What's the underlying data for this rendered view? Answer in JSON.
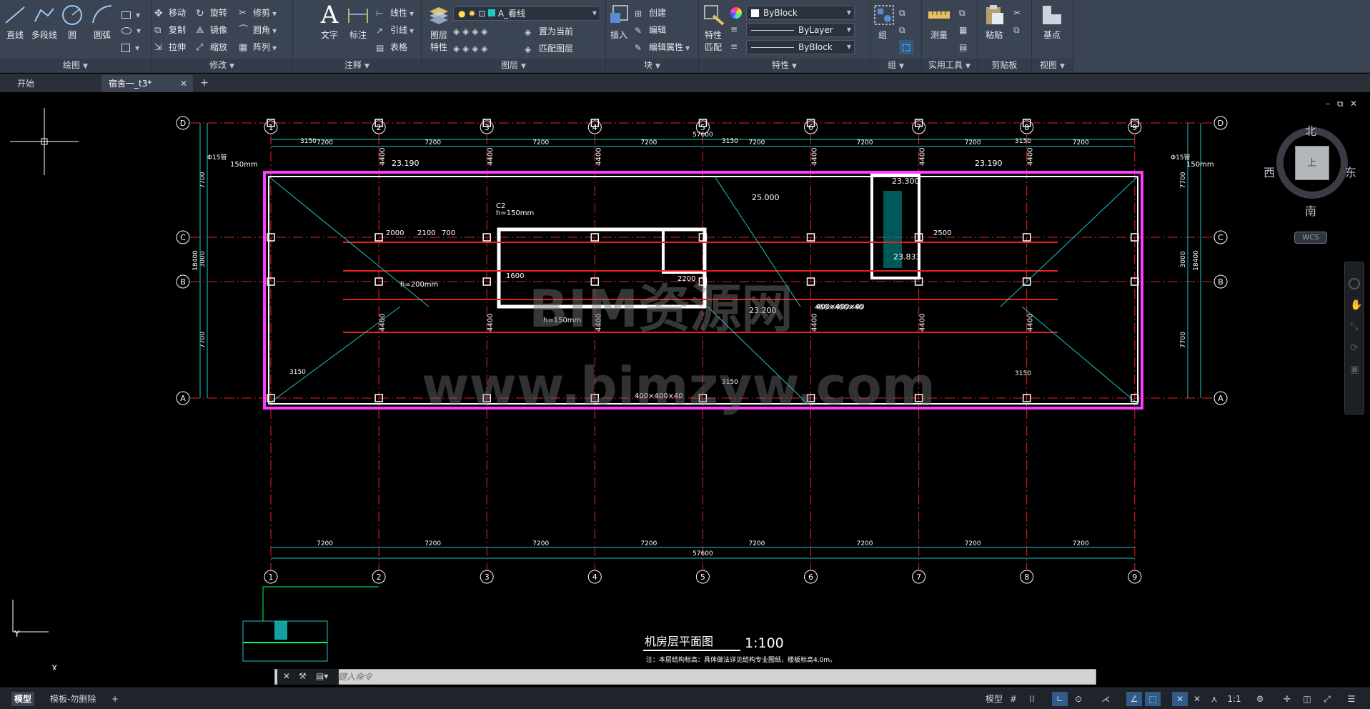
{
  "ribbon": {
    "panels": {
      "draw": {
        "title": "绘图",
        "line": "直线",
        "polyline": "多段线",
        "circle": "圆",
        "arc": "圆弧"
      },
      "modify": {
        "title": "修改",
        "move": "移动",
        "rotate": "旋转",
        "trim": "修剪",
        "copy": "复制",
        "mirror": "镜像",
        "fillet": "圆角",
        "stretch": "拉伸",
        "scale": "缩放",
        "array": "阵列"
      },
      "annotation": {
        "title": "注释",
        "text": "文字",
        "dimension": "标注",
        "linear": "线性",
        "leader": "引线",
        "table": "表格"
      },
      "layers": {
        "title": "图层",
        "layer_props_1": "图层",
        "layer_props_2": "特性",
        "current_layer": "A_看线",
        "set_current": "置为当前",
        "match_layer": "匹配图层"
      },
      "block": {
        "title": "块",
        "insert": "插入",
        "create": "创建",
        "edit": "编辑",
        "edit_attr": "编辑属性"
      },
      "properties": {
        "title": "特性",
        "match_1": "特性",
        "match_2": "匹配",
        "color": "ByBlock",
        "linetype": "ByLayer",
        "lineweight": "ByBlock"
      },
      "groups": {
        "title": "组",
        "group": "组"
      },
      "utilities": {
        "title": "实用工具",
        "measure": "测量"
      },
      "clipboard": {
        "title": "剪贴板",
        "paste": "粘贴"
      },
      "view": {
        "title": "视图",
        "base": "基点"
      }
    }
  },
  "tabs": [
    {
      "label": "开始"
    },
    {
      "label": "宿舍一_t3*"
    }
  ],
  "drawing": {
    "grid_columns": [
      "1",
      "2",
      "3",
      "4",
      "5",
      "6",
      "7",
      "8",
      "9"
    ],
    "grid_rows": [
      "D",
      "C",
      "B",
      "A"
    ],
    "bay_dim": "7200",
    "total_dim": "57600",
    "row_dims_left": [
      "7700",
      "3000",
      "7700"
    ],
    "row_total": "18400",
    "elevation_roof": "25.000",
    "elevation_a": "23.190",
    "elevation_b": "23.190",
    "elevation_c": "23.300",
    "elevation_d": "23.833",
    "elevation_e": "23.200",
    "title": "机房层平面图",
    "scale": "1:100",
    "note": "注：本层结构标高：具体做法详见结构专业图纸，楼板标高4.0m。",
    "watermark": "BIM资源网",
    "watermark_url": "www.bimzyw.com",
    "labels": {
      "pipe_left": "Φ15管",
      "pipe_right": "Φ15管",
      "h150": "150mm",
      "c2_1": "C2",
      "c2_h1": "h=150mm",
      "c2_h2": "h=200mm",
      "c2_h3": "h=150mm",
      "dim_4400": "4400",
      "dim_3150": "3150",
      "dim_2000": "2000",
      "dim_2100": "2100",
      "dim_700": "700",
      "dim_1600": "1600",
      "dim_2200": "2200",
      "dim_2500": "2500",
      "beam": "400×400×40"
    }
  },
  "viewcube": {
    "north": "北",
    "south": "南",
    "west": "西",
    "east": "东",
    "top": "上"
  },
  "wcs": "WCS",
  "command": {
    "placeholder": "键入命令"
  },
  "statusbar": {
    "layout_tabs": [
      {
        "label": "模型"
      },
      {
        "label": "模板-勿删除"
      }
    ],
    "model": "模型",
    "scale": "1:1"
  }
}
